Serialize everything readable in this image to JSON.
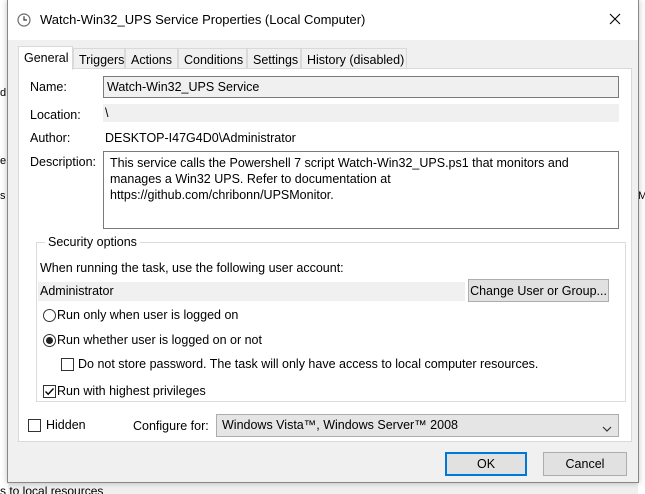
{
  "background": {
    "left_fragments": [
      "d",
      "e",
      "s"
    ],
    "right_fragments": [
      "M"
    ],
    "bottom_text": "s to local resources"
  },
  "window": {
    "title": "Watch-Win32_UPS Service Properties (Local Computer)",
    "icon": "clock-icon",
    "close_icon": "close-icon"
  },
  "tabs": [
    {
      "label": "General",
      "active": true
    },
    {
      "label": "Triggers"
    },
    {
      "label": "Actions"
    },
    {
      "label": "Conditions"
    },
    {
      "label": "Settings"
    },
    {
      "label": "History (disabled)"
    }
  ],
  "general": {
    "name_label": "Name:",
    "name_value": "Watch-Win32_UPS Service",
    "location_label": "Location:",
    "location_value": "\\",
    "author_label": "Author:",
    "author_value": "DESKTOP-I47G4D0\\Administrator",
    "description_label": "Description:",
    "description_value": "This service calls the Powershell 7 script Watch-Win32_UPS.ps1 that monitors and manages a Win32 UPS. Refer to documentation at https://github.com/chribonn/UPSMonitor."
  },
  "security": {
    "group_title": "Security options",
    "account_prompt": "When running the task, use the following user account:",
    "account_value": "Administrator",
    "change_button": "Change User or Group...",
    "radio_logged_on": "Run only when user is logged on",
    "radio_logged_on_checked": false,
    "radio_whether": "Run whether user is logged on or not",
    "radio_whether_checked": true,
    "no_store_password": "Do not store password.  The task will only have access to local computer resources.",
    "no_store_password_checked": false,
    "highest_privileges": "Run with highest privileges",
    "highest_privileges_checked": true
  },
  "bottom": {
    "hidden_label": "Hidden",
    "hidden_checked": false,
    "configure_label": "Configure for:",
    "configure_value": "Windows Vista™, Windows Server™ 2008"
  },
  "buttons": {
    "ok": "OK",
    "cancel": "Cancel"
  },
  "colors": {
    "accent": "#0078d7",
    "dialog_bg": "#f0f0f0",
    "panel_bg": "#ffffff"
  }
}
